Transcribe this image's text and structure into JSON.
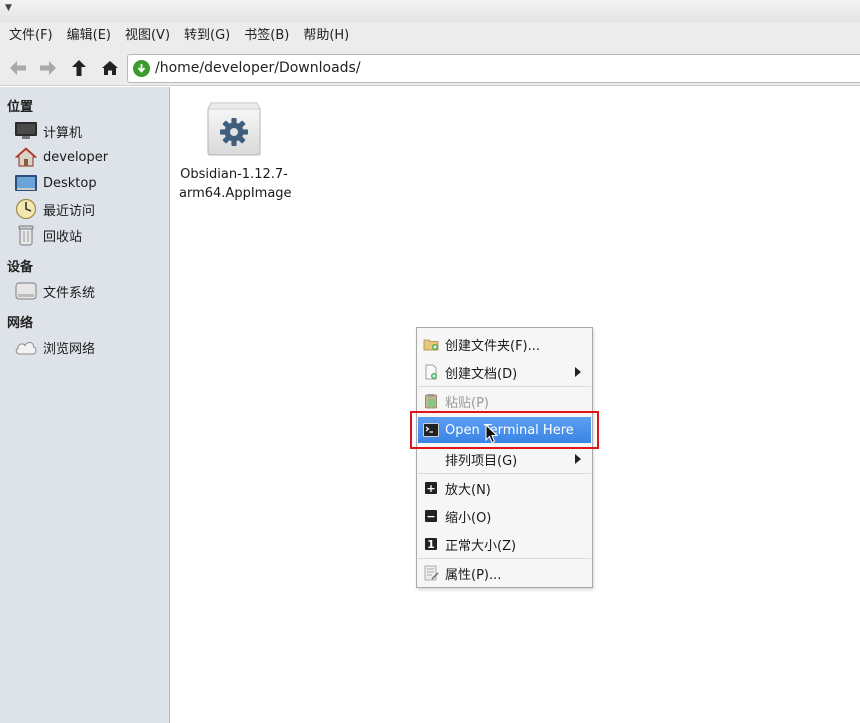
{
  "menubar": {
    "items": [
      "文件(F)",
      "编辑(E)",
      "视图(V)",
      "转到(G)",
      "书签(B)",
      "帮助(H)"
    ]
  },
  "toolbar": {
    "back_icon": "arrow-left-icon",
    "forward_icon": "arrow-right-icon",
    "up_icon": "arrow-up-icon",
    "home_icon": "home-icon",
    "address": "/home/developer/Downloads/"
  },
  "sidebar": {
    "places_heading": "位置",
    "places": [
      {
        "label": "计算机",
        "icon": "computer-icon"
      },
      {
        "label": "developer",
        "icon": "home-folder-icon"
      },
      {
        "label": "Desktop",
        "icon": "desktop-icon"
      },
      {
        "label": "最近访问",
        "icon": "recent-icon"
      },
      {
        "label": "回收站",
        "icon": "trash-icon"
      }
    ],
    "devices_heading": "设备",
    "devices": [
      {
        "label": "文件系统",
        "icon": "drive-icon"
      }
    ],
    "network_heading": "网络",
    "network": [
      {
        "label": "浏览网络",
        "icon": "network-cloud-icon"
      }
    ]
  },
  "content": {
    "files": [
      {
        "name_line1": "Obsidian-1.12.7-",
        "name_line2": "arm64.AppImage",
        "icon": "executable-gear-icon"
      }
    ]
  },
  "context_menu": {
    "items": [
      {
        "label": "创建文件夹(F)...",
        "icon": "new-folder-icon"
      },
      {
        "label": "创建文档(D)",
        "icon": "new-document-icon",
        "submenu": true
      },
      {
        "label": "粘贴(P)",
        "icon": "paste-icon",
        "disabled": true
      },
      {
        "label": "Open Terminal Here",
        "icon": "terminal-icon",
        "highlighted": true
      },
      {
        "label": "排列项目(G)",
        "icon": "",
        "submenu": true
      },
      {
        "label": "放大(N)",
        "icon": "zoom-in-icon"
      },
      {
        "label": "缩小(O)",
        "icon": "zoom-out-icon"
      },
      {
        "label": "正常大小(Z)",
        "icon": "zoom-normal-icon"
      },
      {
        "label": "属性(P)...",
        "icon": "properties-icon"
      }
    ]
  },
  "colors": {
    "highlight": "#3a84e5",
    "annotation_box": "#e0141b",
    "sidebar_bg": "#dee3ea"
  }
}
